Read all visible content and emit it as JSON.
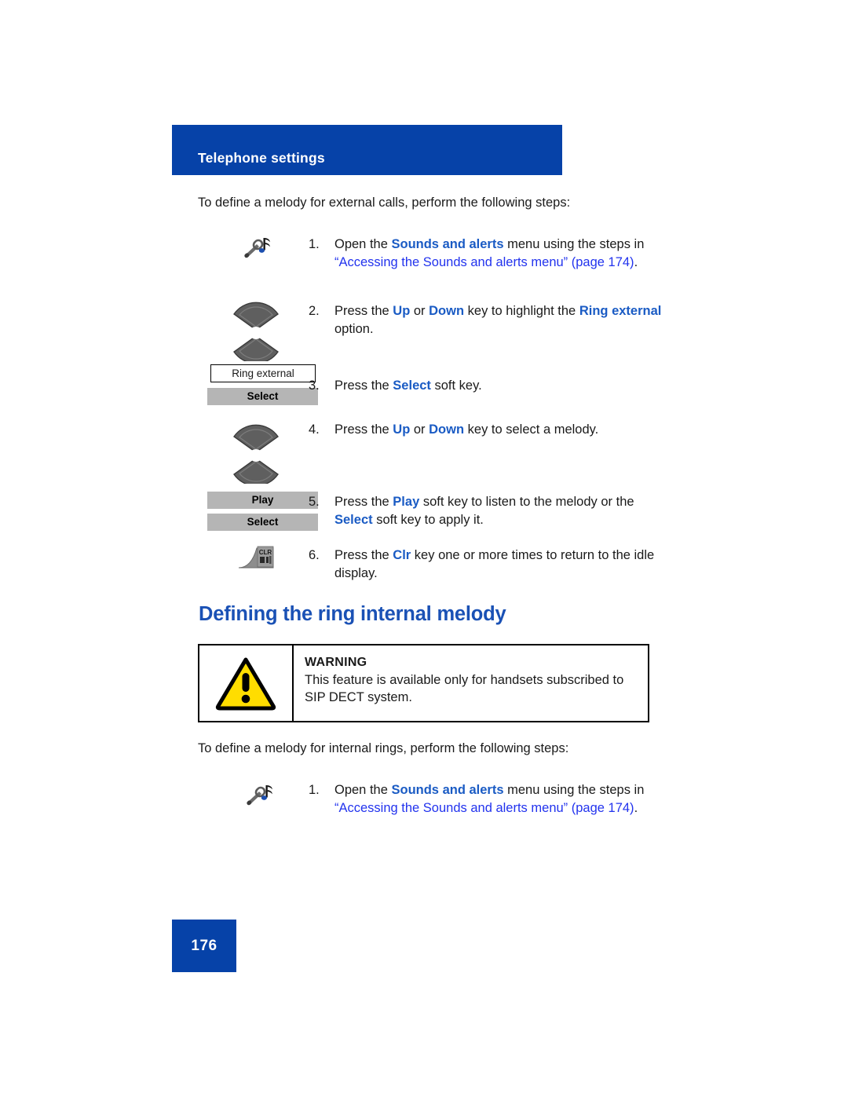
{
  "page": {
    "header_title": "Telephone settings",
    "page_number": "176",
    "accent_blue": "#0642A8",
    "heading_blue": "#1A51B5",
    "keyword_blue": "#1A5BC4",
    "link_blue": "#2233EE",
    "warning_yellow": "#FFDD00",
    "softkey_gray": "#b5b5b5"
  },
  "intro_external": "To define a melody for external calls, perform the following steps:",
  "intro_internal": "To define a melody for internal rings, perform the following steps:",
  "section_heading": "Defining the ring internal melody",
  "steps_external": [
    {
      "num": "1.",
      "icon": "wrench-music-note-icon",
      "text_parts": [
        {
          "t": "Open the ",
          "s": "plain"
        },
        {
          "t": "Sounds and alerts",
          "s": "kw"
        },
        {
          "t": " menu using the steps in ",
          "s": "plain"
        },
        {
          "t": "“Accessing the Sounds and alerts menu” (page 174)",
          "s": "lnk"
        },
        {
          "t": ".",
          "s": "plain"
        }
      ]
    },
    {
      "num": "2.",
      "icon": "nav-up-down-keys-icon",
      "text_parts": [
        {
          "t": "Press the ",
          "s": "plain"
        },
        {
          "t": "Up",
          "s": "kw"
        },
        {
          "t": " or ",
          "s": "plain"
        },
        {
          "t": "Down",
          "s": "kw"
        },
        {
          "t": " key to highlight the ",
          "s": "plain"
        },
        {
          "t": "Ring external",
          "s": "kw"
        },
        {
          "t": " option.",
          "s": "plain"
        }
      ]
    },
    {
      "num": "3.",
      "icon": "lcd-ring-external-and-select-softkey",
      "text_parts": [
        {
          "t": "Press the ",
          "s": "plain"
        },
        {
          "t": "Select",
          "s": "kw"
        },
        {
          "t": " soft key.",
          "s": "plain"
        }
      ]
    },
    {
      "num": "4.",
      "icon": "nav-up-down-keys-icon",
      "text_parts": [
        {
          "t": "Press the ",
          "s": "plain"
        },
        {
          "t": "Up",
          "s": "kw"
        },
        {
          "t": " or ",
          "s": "plain"
        },
        {
          "t": "Down",
          "s": "kw"
        },
        {
          "t": " key to select a melody.",
          "s": "plain"
        }
      ]
    },
    {
      "num": "5.",
      "icon": "play-and-select-softkeys",
      "text_parts": [
        {
          "t": "Press the ",
          "s": "plain"
        },
        {
          "t": "Play",
          "s": "kw"
        },
        {
          "t": " soft key to listen to the melody or the ",
          "s": "plain"
        },
        {
          "t": "Select",
          "s": "kw"
        },
        {
          "t": " soft key to apply it.",
          "s": "plain"
        }
      ]
    },
    {
      "num": "6.",
      "icon": "clr-key-icon",
      "text_parts": [
        {
          "t": "Press the ",
          "s": "plain"
        },
        {
          "t": "Clr",
          "s": "kw"
        },
        {
          "t": " key one or more times to return to the idle display.",
          "s": "plain"
        }
      ]
    }
  ],
  "steps_internal": [
    {
      "num": "1.",
      "icon": "wrench-music-note-icon",
      "text_parts": [
        {
          "t": "Open the ",
          "s": "plain"
        },
        {
          "t": "Sounds and alerts",
          "s": "kw"
        },
        {
          "t": " menu using the steps in ",
          "s": "plain"
        },
        {
          "t": "“Accessing the Sounds and alerts menu” (page 174)",
          "s": "lnk"
        },
        {
          "t": ".",
          "s": "plain"
        }
      ]
    }
  ],
  "lcd_labels": {
    "ring_external": "Ring external",
    "select_1": "Select",
    "play": "Play",
    "select_2": "Select"
  },
  "warning": {
    "title": "WARNING",
    "body": "This feature is available only for handsets subscribed to SIP DECT system."
  }
}
